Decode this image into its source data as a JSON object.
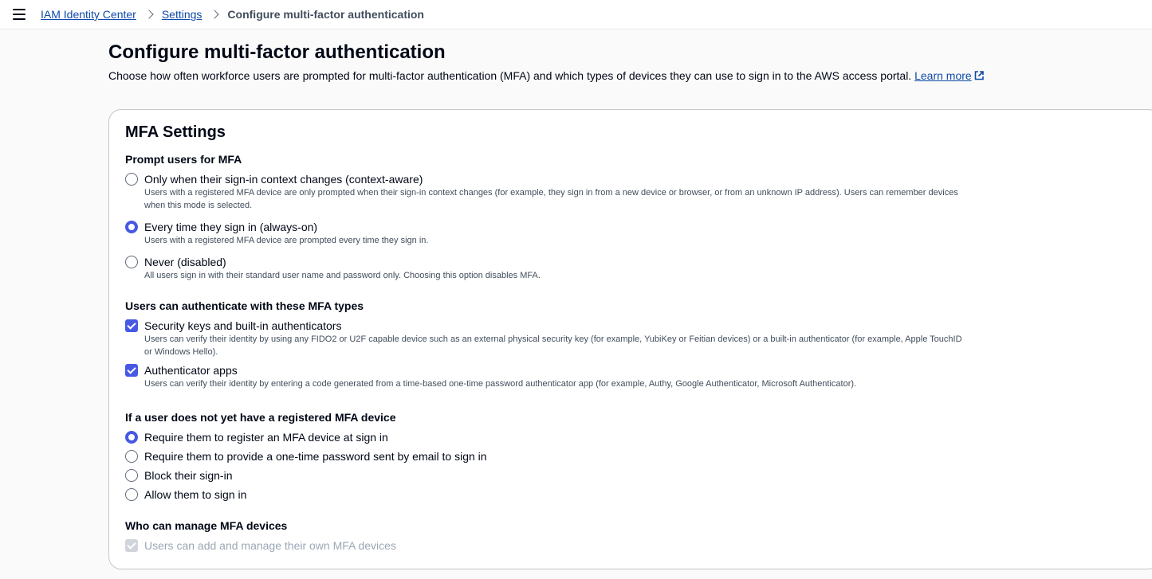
{
  "breadcrumb": {
    "items": [
      "IAM Identity Center",
      "Settings"
    ],
    "current": "Configure multi-factor authentication"
  },
  "page": {
    "title": "Configure multi-factor authentication",
    "description": "Choose how often workforce users are prompted for multi-factor authentication (MFA) and which types of devices they can use to sign in to the AWS access portal.",
    "learn_more": "Learn more"
  },
  "card": {
    "title": "MFA Settings",
    "prompt": {
      "label": "Prompt users for MFA",
      "options": [
        {
          "label": "Only when their sign-in context changes (context-aware)",
          "desc": "Users with a registered MFA device are only prompted when their sign-in context changes (for example, they sign in from a new device or browser, or from an unknown IP address). Users can remember devices when this mode is selected.",
          "checked": false
        },
        {
          "label": "Every time they sign in (always-on)",
          "desc": "Users with a registered MFA device are prompted every time they sign in.",
          "checked": true
        },
        {
          "label": "Never (disabled)",
          "desc": "All users sign in with their standard user name and password only. Choosing this option disables MFA.",
          "checked": false
        }
      ]
    },
    "types": {
      "label": "Users can authenticate with these MFA types",
      "options": [
        {
          "label": "Security keys and built-in authenticators",
          "desc": "Users can verify their identity by using any FIDO2 or U2F capable device such as an external physical security key (for example, YubiKey or Feitian devices) or a built-in authenticator (for example, Apple TouchID or Windows Hello).",
          "checked": true
        },
        {
          "label": "Authenticator apps",
          "desc": "Users can verify their identity by entering a code generated from a time-based one-time password authenticator app (for example, Authy, Google Authenticator, Microsoft Authenticator).",
          "checked": true
        }
      ]
    },
    "no_device": {
      "label": "If a user does not yet have a registered MFA device",
      "options": [
        {
          "label": "Require them to register an MFA device at sign in",
          "checked": true
        },
        {
          "label": "Require them to provide a one-time password sent by email to sign in",
          "checked": false
        },
        {
          "label": "Block their sign-in",
          "checked": false
        },
        {
          "label": "Allow them to sign in",
          "checked": false
        }
      ]
    },
    "manage": {
      "label": "Who can manage MFA devices",
      "option": {
        "label": "Users can add and manage their own MFA devices",
        "checked": true,
        "disabled": true
      }
    }
  },
  "colors": {
    "accent": "#4759e3",
    "link": "#0f4aa8"
  }
}
